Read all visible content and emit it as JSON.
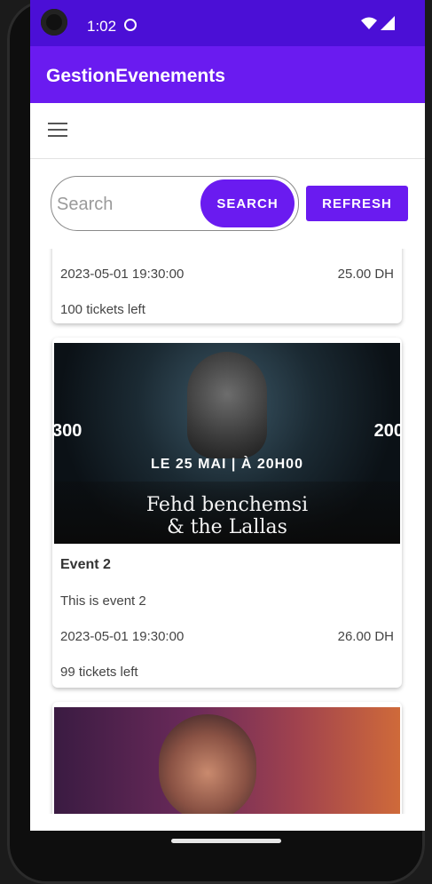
{
  "status_bar": {
    "time": "1:02"
  },
  "app": {
    "title": "GestionEvenements"
  },
  "search": {
    "placeholder": "Search",
    "value": "",
    "search_label": "SEARCH",
    "refresh_label": "REFRESH"
  },
  "events": [
    {
      "title": "",
      "description": "",
      "datetime": "2023-05-01 19:30:00",
      "price": "25.00 DH",
      "tickets": "100 tickets left"
    },
    {
      "title": "Event 2",
      "description": "This is event 2",
      "datetime": "2023-05-01 19:30:00",
      "price": "26.00 DH",
      "tickets": "99 tickets left",
      "poster": {
        "date_text": "LE 25 MAI | À 20H00",
        "name_line1": "Fehd benchemsi",
        "name_line2": "& the Lallas",
        "price_left": "300",
        "price_right": "200"
      }
    },
    {
      "title": "",
      "description": "",
      "datetime": "",
      "price": "",
      "tickets": ""
    }
  ],
  "colors": {
    "status_bar": "#4b0fd6",
    "app_bar": "#6a1bf0",
    "accent": "#6a1bf0"
  }
}
